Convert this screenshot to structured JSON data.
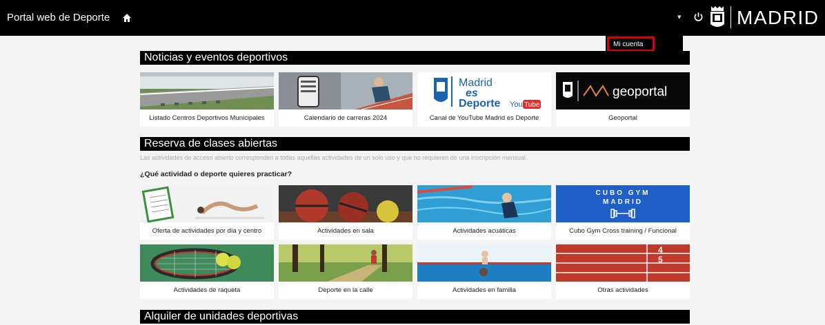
{
  "header": {
    "site_title": "Portal web de Deporte",
    "logo_text": "MADRID",
    "icons": [
      "home-icon",
      "caret-down-icon",
      "power-icon",
      "madrid-crest-icon"
    ]
  },
  "account_menu": {
    "label": "Mi cuenta"
  },
  "sections": {
    "news": "Noticias y eventos deportivos",
    "classes": "Reserva de clases abiertas",
    "rental": "Alquiler de unidades deportivas"
  },
  "classes_intro": "Las actividades de acceso abierto corresponden a todas aquellas actividades de un solo uso y que no requieren de una inscripción mensual.",
  "classes_question": "¿Qué actividad o deporte quieres practicar?",
  "news_cards": [
    {
      "caption": "Listado Centros Deportivos Municipales"
    },
    {
      "caption": "Calendario de carreras 2024"
    },
    {
      "caption": "Canal de YouTube Madrid es Deporte",
      "logo_lines": [
        "Madrid",
        "es",
        "Deporte"
      ],
      "badge_prefix": "You",
      "badge": "Tube"
    },
    {
      "caption": "Geoportal",
      "logo": "geoportal"
    }
  ],
  "activity_cards": [
    {
      "caption": "Oferta de actividades por día y centro"
    },
    {
      "caption": "Actividades en sala"
    },
    {
      "caption": "Actividades acuáticas"
    },
    {
      "caption": "Cubo Gym Cross training / Funcional",
      "logo_lines": [
        "CUBO GYM",
        "MADRID"
      ]
    },
    {
      "caption": "Actividades de raqueta"
    },
    {
      "caption": "Deporte en la calle"
    },
    {
      "caption": "Actividades en familia"
    },
    {
      "caption": "Otras actividades",
      "track_numbers": [
        "4",
        "5"
      ]
    }
  ],
  "colors": {
    "header_bg": "#000000",
    "highlight": "#e00000",
    "page_bg": "#f4f4f4",
    "cubo_blue": "#1e5fc8",
    "track_red": "#c0392b"
  }
}
